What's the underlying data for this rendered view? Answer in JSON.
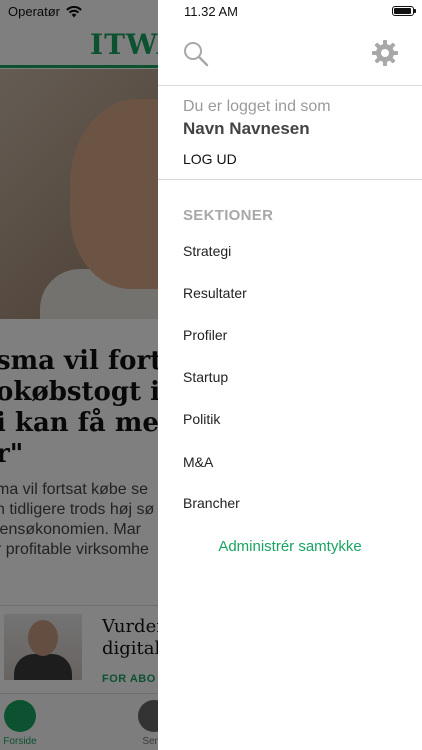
{
  "status_bar": {
    "carrier": "Operatør",
    "time": "11.32 AM",
    "battery_level": 0.95
  },
  "background": {
    "logo": "ITWA",
    "headline": "sma vil forts\nokøbstogt i u\ni kan få mer\nr\"",
    "lead": "ma vil fortsat købe se\nn tidligere trods høj sø\nlensøkonomien. Mar\nr profitable virksomhe",
    "card_title": "Vurder\ndigital",
    "card_tag": "FOR ABO",
    "tabs": [
      {
        "label": "Forside",
        "icon": "home-icon"
      },
      {
        "label": "Sene",
        "icon": "clock-icon"
      }
    ]
  },
  "drawer": {
    "search_icon": "search-icon",
    "settings_icon": "gear-icon",
    "login_caption": "Du er logget ind som",
    "user_name": "Navn Navnesen",
    "logout_label": "LOG UD",
    "section_heading": "SEKTIONER",
    "items": [
      {
        "label": "Strategi"
      },
      {
        "label": "Resultater"
      },
      {
        "label": "Profiler"
      },
      {
        "label": "Startup"
      },
      {
        "label": "Politik"
      },
      {
        "label": "M&A"
      },
      {
        "label": "Brancher"
      }
    ],
    "consent_label": "Administrér samtykke"
  },
  "colors": {
    "accent": "#19a463",
    "overlay": "#000000"
  }
}
